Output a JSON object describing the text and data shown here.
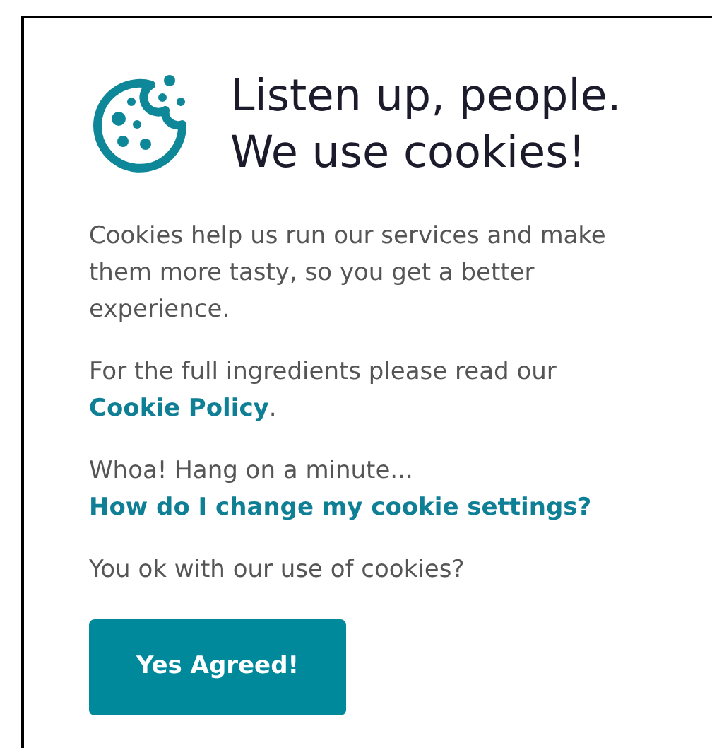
{
  "dialog": {
    "title": "Listen up, people. We use cookies!",
    "paragraphs": [
      {
        "text": "Cookies help us run our services and make them more tasty, so you get a better experience."
      },
      {
        "text": "For the full ingredients please read our",
        "link": "Cookie Policy",
        "after": "."
      },
      {
        "text": "Whoa! Hang on a minute...",
        "link": "How do I change my cookie settings?"
      },
      {
        "text": "You ok with our use of cookies?"
      }
    ],
    "button": "Yes Agreed!"
  }
}
